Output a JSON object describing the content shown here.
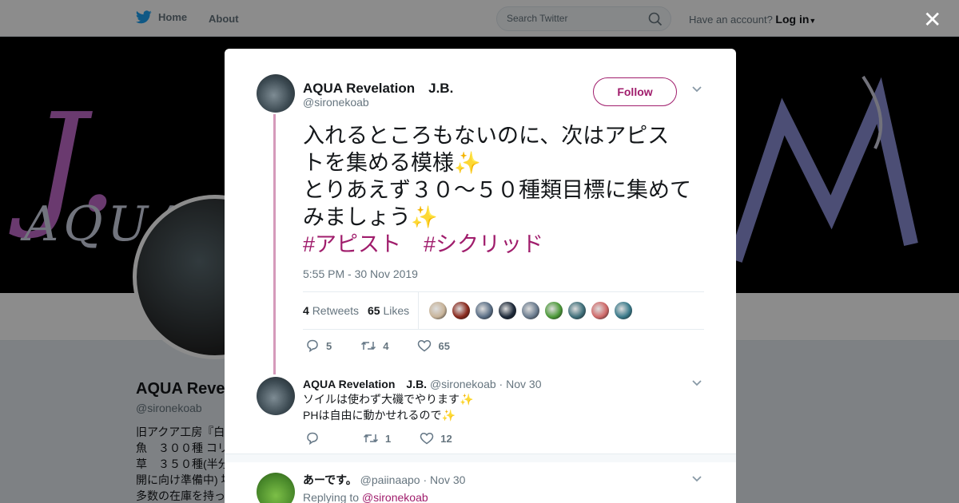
{
  "nav": {
    "home_label": "Home",
    "about_label": "About",
    "search_placeholder": "Search Twitter",
    "account_prompt": "Have an account?",
    "login_label": "Log in"
  },
  "profile": {
    "name": "AQUA Revelation　J.B.",
    "name_visible": "AQUA Reve",
    "handle": "@sironekoab",
    "bio_lines": [
      "旧アクア工房『白",
      "魚　３００種 コリ",
      "草　３５０種(半分",
      "開に向け準備中) 場",
      "多数の在庫を持っ"
    ],
    "banner_text": "AQUA"
  },
  "modal": {
    "close_label": "✕",
    "main_tweet": {
      "name": "AQUA Revelation　J.B.",
      "handle": "@sironekoab",
      "follow_label": "Follow",
      "text_lines": [
        "入れるところもないのに、次はアピス",
        "トを集める模様✨",
        "とりあえず３０～５０種類目標に集めて",
        "みましょう✨"
      ],
      "hashtags": [
        "#アピスト",
        "#シクリッド"
      ],
      "timestamp": "5:55 PM - 30 Nov 2019",
      "retweets_count": "4",
      "retweets_label": "Retweets",
      "likes_count": "65",
      "likes_label": "Likes",
      "liker_colors": [
        "#c8b49a",
        "#8a2a1e",
        "#5b6f86",
        "#1e2a3a",
        "#6b7c8f",
        "#4d9a3a",
        "#3f6f7a",
        "#d06a6a",
        "#3a7a8a"
      ],
      "reply_count": "5",
      "retweet_count": "4",
      "like_count": "65"
    },
    "replies": [
      {
        "name": "AQUA Revelation　J.B.",
        "handle": "@sironekoab",
        "date": "Nov 30",
        "text_lines": [
          "ソイルは使わず大磯でやります✨",
          "PHは自由に動かせれるので✨"
        ],
        "reply_count": "",
        "retweet_count": "1",
        "like_count": "12"
      },
      {
        "name": "あーです。",
        "handle": "@paiinaapo",
        "date": "Nov 30",
        "replying_prefix": "Replying to",
        "replying_to": "@sironekoab"
      }
    ]
  },
  "colors": {
    "accent": "#a01d6c",
    "twitter_blue": "#1da1f2",
    "thread_line": "#d59aba"
  }
}
